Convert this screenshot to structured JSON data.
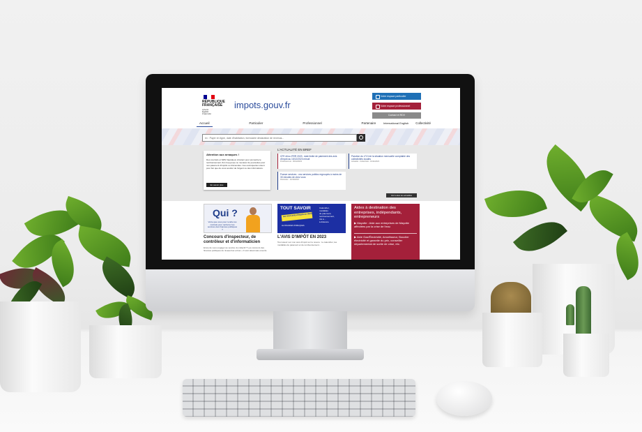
{
  "website": {
    "logo": {
      "republique": "RÉPUBLIQUE\nFRANÇAISE",
      "motto": "Liberté\nÉgalité\nFraternité",
      "brand": "impots.gouv.fr"
    },
    "buttons": {
      "particulier": "Votre espace particulier",
      "professionnel": "Votre espace professionnel",
      "contact": "Contact et RDV"
    },
    "nav": [
      "Accueil",
      "Particulier",
      "Professionnel",
      "Partenaire",
      "Collectivité"
    ],
    "lang": "International  English",
    "search_placeholder": "ex : Payer en ligne, date d'habitation, formulaire déclaration de revenus...",
    "alert": {
      "title": "Attention aux arnaques !",
      "body": "Des courriels et SMS frauduleux circulent pour promettre le remboursement d'un trop-perçu ou menacer de poursuites pour non-paiement d'impôts ou d'amendes. Ces escroqueries visent pour but que de vous soutirer de l'argent ou des informations.",
      "button": "En savoir plus"
    },
    "news": {
      "title": "L'ACTUALITÉ EN BREF",
      "items": [
        {
          "text": "CFE et/ou IFER 2023 : date limite de paiement des avis d'impôt au 15/12/2023 minuit",
          "meta": "Professionnel - 06/12/2023"
        },
        {
          "text": "Parution du n°13 de la situation mensuelle comptable des collectivités locales",
          "meta": "Actualité - Collectivité - 16/11/2023"
        },
        {
          "text": "France services : vos services publics regroupés à moins de 30 minutes de chez vous",
          "meta": "Particulier - 23/10/2023"
        }
      ],
      "all_button": "Voir toutes les actualités"
    },
    "cards": {
      "c1": {
        "img_title": "Qui ?",
        "img_sub": "Votre que vous pour rendre les contrats pour renforcer les services des finances publiques ?",
        "title": "Concours d'inspecteur, de contrôleur et d'informaticien",
        "body": "Envie de vous engager au service du collectif ? Les concours des finances publiques de niveau bac et bac + 3 sont désormais ouverts."
      },
      "c2": {
        "img_title": "TOUT SAVOIR",
        "sticker": "sur mon avis d'impôt en 2023",
        "img_list": "Calendrier,\nmodalités\nde paiement,\nremboursement,\nrdv à ...\nà distance",
        "img_logo": "LE FINANCES PUBLIQUES",
        "title": "L'AVIS D'IMPÔT EN 2023",
        "body": "Tout savoir sur mon avis d'impôt sur le revenu : le calendrier, les modalités de paiement et de remboursement..."
      },
      "c3": {
        "title": "Aides à destination des entreprises, indépendants, entrepreneurs",
        "p1": "▶ Mayotte : Aide aux entreprises de Mayotte affectées par la crise de l'eau",
        "p2": "▶ Aide Gaz/Électricité, Amortisseur, Bouclier électricité et garantie du prix, conseiller départemental de sortie de crise, etc."
      }
    }
  },
  "colors": {
    "brand_blue": "#2a4b9b",
    "marianne_red": "#a4203a",
    "button_blue": "#1f70b6"
  }
}
